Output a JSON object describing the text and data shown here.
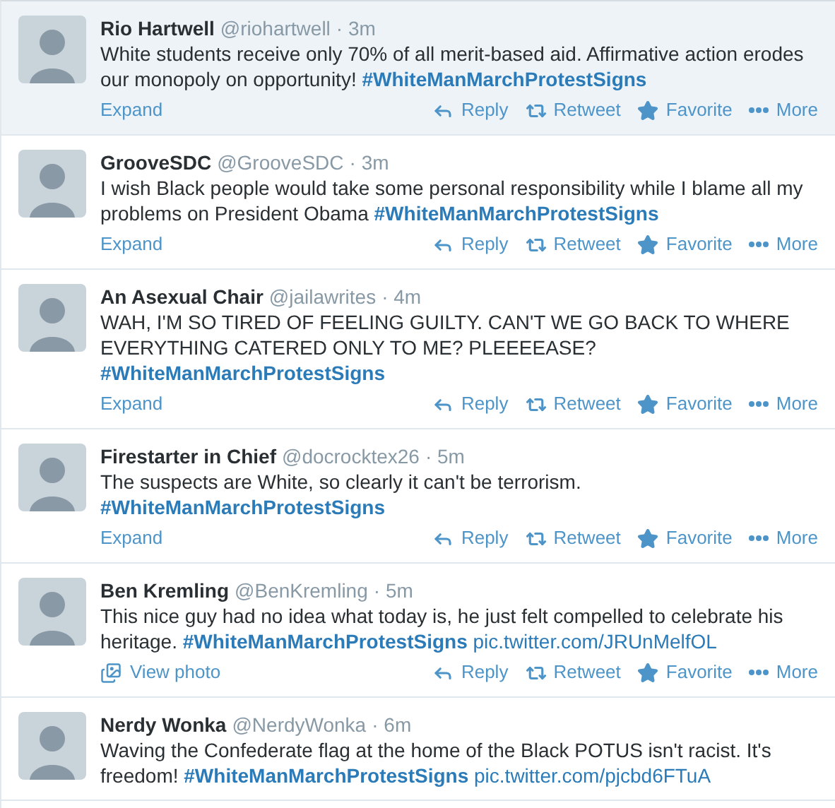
{
  "tweets": [
    {
      "name": "Rio Hartwell",
      "handle": "@riohartwell",
      "time": "· 3m",
      "highlighted": true,
      "body": [
        {
          "kind": "text",
          "text": "White students receive only 70% of all merit-based aid. Affirmative action erodes our monopoly on opportunity!"
        },
        {
          "kind": "hashtag",
          "text": "#WhiteManMarchProtestSigns"
        }
      ],
      "footer": {
        "kind": "expand",
        "label": "Expand"
      },
      "actions": [
        "Reply",
        "Retweet",
        "Favorite",
        "More"
      ]
    },
    {
      "name": "GrooveSDC",
      "handle": "@GrooveSDC",
      "time": "· 3m",
      "highlighted": false,
      "body": [
        {
          "kind": "text",
          "text": "I wish Black people would take some personal responsibility while I blame all my problems on President Obama"
        },
        {
          "kind": "hashtag",
          "text": "#WhiteManMarchProtestSigns"
        }
      ],
      "footer": {
        "kind": "expand",
        "label": "Expand"
      },
      "actions": [
        "Reply",
        "Retweet",
        "Favorite",
        "More"
      ]
    },
    {
      "name": "An Asexual Chair",
      "handle": "@jailawrites",
      "time": "· 4m",
      "highlighted": false,
      "body": [
        {
          "kind": "text",
          "text": "WAH, I'M SO TIRED OF FEELING GUILTY.  CAN'T WE GO BACK TO WHERE EVERYTHING CATERED ONLY TO ME?  PLEEEEASE?"
        },
        {
          "kind": "hashtag",
          "text": "#WhiteManMarchProtestSigns"
        }
      ],
      "footer": {
        "kind": "expand",
        "label": "Expand"
      },
      "actions": [
        "Reply",
        "Retweet",
        "Favorite",
        "More"
      ]
    },
    {
      "name": "Firestarter in Chief",
      "handle": "@docrocktex26",
      "time": "· 5m",
      "highlighted": false,
      "body": [
        {
          "kind": "text",
          "text": "The suspects are White, so clearly it can't be terrorism."
        },
        {
          "kind": "hashtag",
          "text": "#WhiteManMarchProtestSigns"
        }
      ],
      "footer": {
        "kind": "expand",
        "label": "Expand"
      },
      "actions": [
        "Reply",
        "Retweet",
        "Favorite",
        "More"
      ]
    },
    {
      "name": "Ben Kremling",
      "handle": "@BenKremling",
      "time": "· 5m",
      "highlighted": false,
      "body": [
        {
          "kind": "text",
          "text": "This nice guy had no idea what today is, he just felt compelled to celebrate his heritage."
        },
        {
          "kind": "hashtag",
          "text": "#WhiteManMarchProtestSigns"
        },
        {
          "kind": "link",
          "text": "pic.twitter.com/JRUnMelfOL"
        }
      ],
      "footer": {
        "kind": "photo",
        "label": "View photo"
      },
      "actions": [
        "Reply",
        "Retweet",
        "Favorite",
        "More"
      ]
    },
    {
      "name": "Nerdy Wonka",
      "handle": "@NerdyWonka",
      "time": "· 6m",
      "highlighted": false,
      "body": [
        {
          "kind": "text",
          "text": "Waving the Confederate flag at the home of the Black POTUS isn't racist. It's freedom!"
        },
        {
          "kind": "hashtag",
          "text": "#WhiteManMarchProtestSigns"
        },
        {
          "kind": "link",
          "text": "pic.twitter.com/pjcbd6FTuA"
        }
      ]
    }
  ]
}
